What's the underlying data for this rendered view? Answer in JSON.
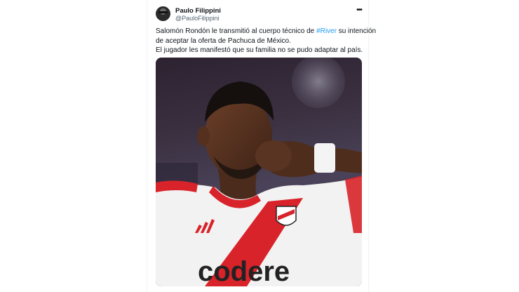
{
  "tweet": {
    "author_name": "Paulo Filippini",
    "author_handle": "@PauloFilippini",
    "text_line1_before": "Salomón Rondón le transmitió al cuerpo técnico de ",
    "hashtag": "#River",
    "text_line1_after": " su intención",
    "text_line2": "de aceptar la oferta de Pachuca de México.",
    "text_line3": "El jugador les manifestó que su familia no se pudo adaptar al país."
  },
  "media": {
    "sponsor": "codere",
    "description_icon": "footballer-kissing-fist-photo"
  },
  "icons": {
    "more": "more-options-icon"
  },
  "colors": {
    "hashtag": "#1d9bf0",
    "text": "#0f1419",
    "secondary": "#536471"
  }
}
